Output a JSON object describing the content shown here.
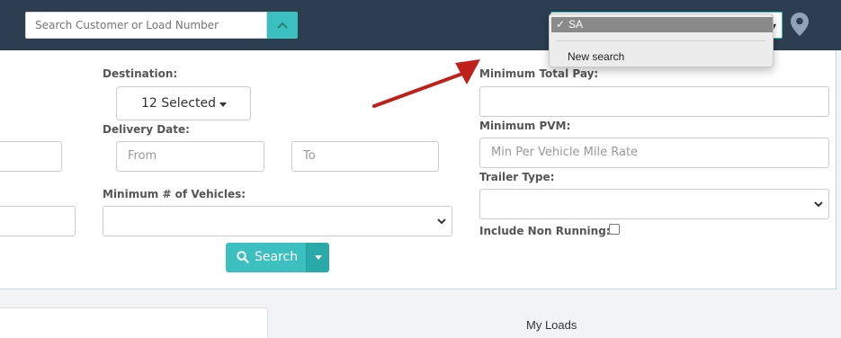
{
  "navbar": {
    "search_placeholder": "Search Customer or Load Number",
    "saved_search_selected": "SA"
  },
  "saved_search_menu": {
    "check": "✓",
    "selected": "SA",
    "items": [
      "New search"
    ]
  },
  "form": {
    "destination_label": "Destination:",
    "destination_button": "12 Selected",
    "delivery_date_label": "Delivery Date:",
    "from_placeholder": "From",
    "to_placeholder": "To",
    "min_vehicles_label": "Minimum # of Vehicles:",
    "min_total_pay_label": "Minimum Total Pay:",
    "min_pvm_label": "Minimum PVM:",
    "min_pvm_placeholder": "Min Per Vehicle Mile Rate",
    "trailer_type_label": "Trailer Type:",
    "include_non_running_label": "Include Non Running:",
    "search_button": "Search"
  },
  "tabs": {
    "my_loads": "My Loads"
  },
  "colors": {
    "navbar": "#2c3e50",
    "accent": "#3bbfbf",
    "annotation_arrow": "#c0201a"
  }
}
